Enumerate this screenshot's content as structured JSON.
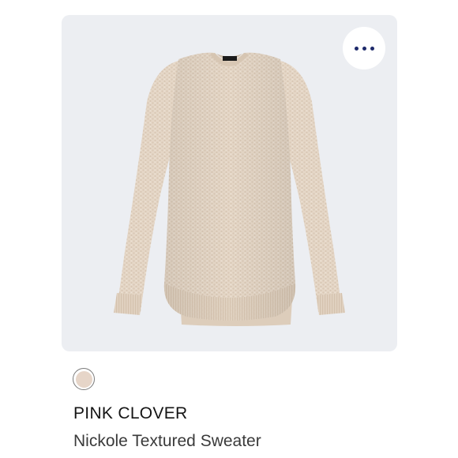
{
  "product": {
    "brand": "PINK CLOVER",
    "name": "Nickole Textured Sweater",
    "swatch_color": "#e6d5c8",
    "garment_color": "#e4d6c6",
    "label_text": "Pink Clover"
  },
  "actions": {
    "more_icon": "more-horizontal-icon"
  },
  "colors": {
    "card_background": "#eceef2",
    "dots": "#1e2a6b",
    "brand_text": "#141414",
    "name_text": "#3a3a3a"
  }
}
